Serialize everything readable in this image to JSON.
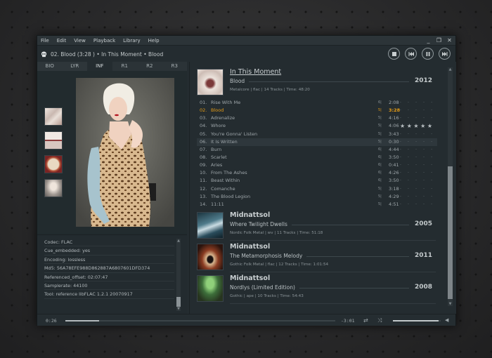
{
  "menu": [
    "File",
    "Edit",
    "View",
    "Playback",
    "Library",
    "Help"
  ],
  "window_controls": {
    "minimize": "_",
    "restore": "❐",
    "close": "✕"
  },
  "now_playing": "02. Blood (3:28 )  •  In This Moment  •  Blood",
  "transport": {
    "stop": "stop-icon",
    "previous": "previous-icon",
    "pause": "pause-icon",
    "next": "next-icon"
  },
  "tabs": [
    "BIO",
    "LYR",
    "INF",
    "R1",
    "R2",
    "R3"
  ],
  "active_tab": "INF",
  "info": [
    "Codec:  FLAC",
    "Cue_embedded:  yes",
    "Encoding:  lossless",
    "Md5:  56A78EFE988D862887A6807601DFD374",
    "Referenced_offset:  02:07:47",
    "Samplerate:  44100",
    "Tool:  reference libFLAC 1.2.1 20070917"
  ],
  "albums": [
    {
      "artist": "In This Moment",
      "title": "Blood",
      "year": "2012",
      "meta": "Metalcore | flac | 14 Tracks | Time: 48:20"
    },
    {
      "artist": "Midnattsol",
      "title": "Where Twilight Dwells",
      "year": "2005",
      "meta": "Nordic Folk Metal | wv | 11 Tracks | Time: 51:18"
    },
    {
      "artist": "Midnattsol",
      "title": "The Metamorphosis Melody",
      "year": "2011",
      "meta": "Gothic Folk Metal | flac | 12 Tracks | Time: 1:01:54"
    },
    {
      "artist": "Midnattsol",
      "title": "Nordlys (Limited Edition)",
      "year": "2008",
      "meta": "Gothic | ape | 10 Tracks | Time: 54:43"
    }
  ],
  "tracks": [
    {
      "num": "01.",
      "name": "Rise With Me",
      "q": "6|",
      "dur": "2:08",
      "rating": 0
    },
    {
      "num": "02.",
      "name": "Blood",
      "q": "5|",
      "dur": "3:28",
      "rating": 0
    },
    {
      "num": "03.",
      "name": "Adrenalize",
      "q": "5|",
      "dur": "4:16",
      "rating": 0
    },
    {
      "num": "04.",
      "name": "Whore",
      "q": "5|",
      "dur": "4:06",
      "rating": 5
    },
    {
      "num": "05.",
      "name": "You're Gonna' Listen",
      "q": "5|",
      "dur": "3:43",
      "rating": 0
    },
    {
      "num": "06.",
      "name": "It Is Written",
      "q": "5|",
      "dur": "0:30",
      "rating": 0
    },
    {
      "num": "07.",
      "name": "Burn",
      "q": "6|",
      "dur": "4:44",
      "rating": 0
    },
    {
      "num": "08.",
      "name": "Scarlet",
      "q": "6|",
      "dur": "3:50",
      "rating": 0
    },
    {
      "num": "09.",
      "name": "Aries",
      "q": "6|",
      "dur": "0:41",
      "rating": 0
    },
    {
      "num": "10.",
      "name": "From The Ashes",
      "q": "6|",
      "dur": "4:26",
      "rating": 0
    },
    {
      "num": "11.",
      "name": "Beast Within",
      "q": "6|",
      "dur": "3:50",
      "rating": 0
    },
    {
      "num": "12.",
      "name": "Comanche",
      "q": "5|",
      "dur": "3:18",
      "rating": 0
    },
    {
      "num": "13.",
      "name": "The Blood Legion",
      "q": "5|",
      "dur": "4:29",
      "rating": 0
    },
    {
      "num": "14.",
      "name": "11:11",
      "q": "5|",
      "dur": "4:51",
      "rating": 0
    }
  ],
  "playing_index": 1,
  "selected_index": 5,
  "colors": {
    "accent": "#e59c16",
    "background": "#242c30"
  },
  "playback": {
    "elapsed": "0:26",
    "remaining": "-3:01",
    "progress": 0.125,
    "volume": 0.95
  }
}
